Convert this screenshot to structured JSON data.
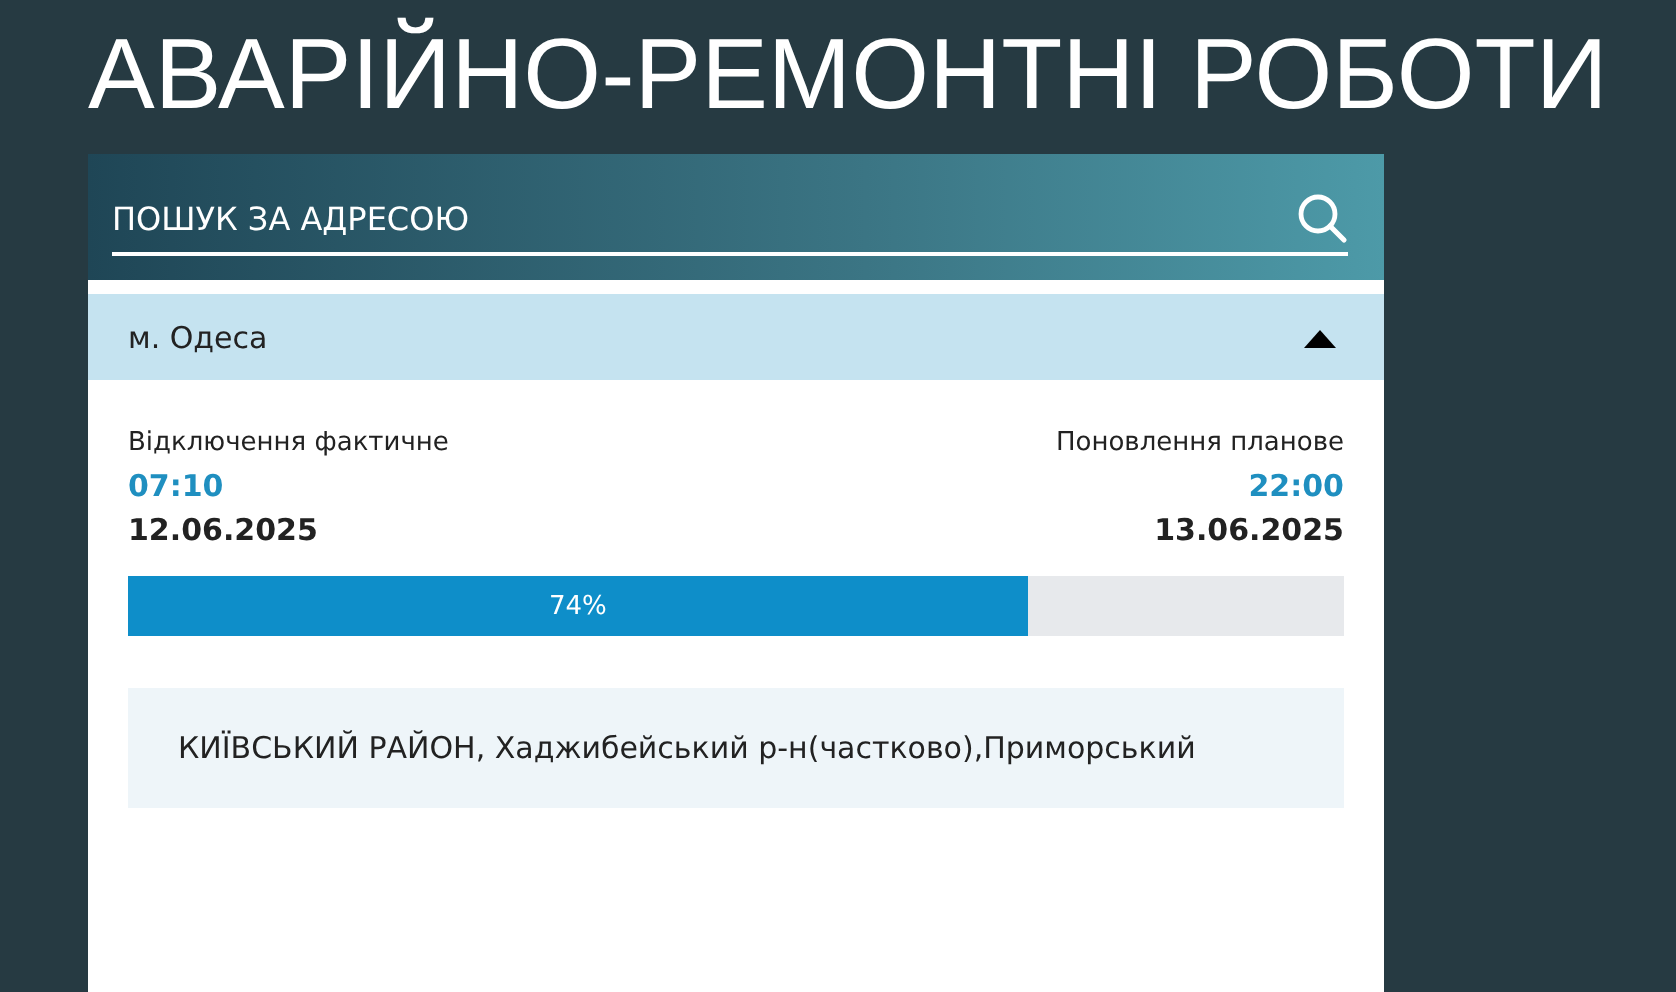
{
  "page_title": "АВАРІЙНО-РЕМОНТНІ РОБОТИ",
  "search": {
    "placeholder": "ПОШУК ЗА АДРЕСОЮ"
  },
  "city": {
    "name": "м. Одеса",
    "expanded": true
  },
  "outage": {
    "start_label": "Відключення фактичне",
    "start_time": "07:10",
    "start_date": "12.06.2025",
    "end_label": "Поновлення планове",
    "end_time": "22:00",
    "end_date": "13.06.2025",
    "level": 0.74,
    "progress_text": "74%"
  },
  "areas": [
    "КИЇВСЬКИЙ РАЙОН, Хаджибейський р-н(частково),Приморський"
  ]
}
